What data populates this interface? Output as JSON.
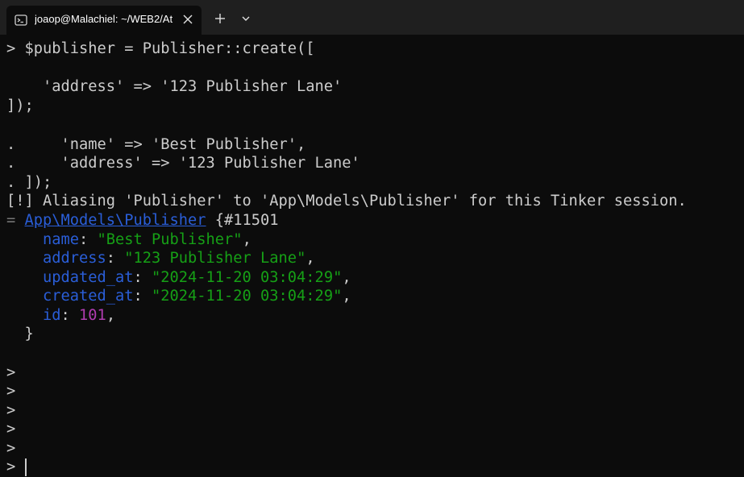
{
  "tab": {
    "title": "joaop@Malachiel: ~/WEB2/At",
    "icon": "terminal-icon"
  },
  "terminal": {
    "input1": "> $publisher = Publisher::create([",
    "input1_addr": "    'address' => '123 Publisher Lane'",
    "input1_close": "]);",
    "cont_name": ".     'name' => 'Best Publisher',",
    "cont_addr": ".     'address' => '123 Publisher Lane'",
    "cont_close": ". ]);",
    "alias_msg": "[!] Aliasing 'Publisher' to 'App\\Models\\Publisher' for this Tinker session.",
    "result_prefix": "= ",
    "result_class": "App\\Models\\Publisher",
    "result_id": " {#11501",
    "fields": [
      {
        "key": "name",
        "value": "\"Best Publisher\"",
        "type": "str"
      },
      {
        "key": "address",
        "value": "\"123 Publisher Lane\"",
        "type": "str"
      },
      {
        "key": "updated_at",
        "value": "\"2024-11-20 03:04:29\"",
        "type": "str"
      },
      {
        "key": "created_at",
        "value": "\"2024-11-20 03:04:29\"",
        "type": "str"
      },
      {
        "key": "id",
        "value": "101",
        "type": "num"
      }
    ],
    "result_close": "  }",
    "prompt": ">"
  },
  "colors": {
    "background": "#0c0c0c",
    "text": "#cccccc",
    "key": "#2a5ed8",
    "string": "#16a016",
    "number": "#b03cb0"
  }
}
